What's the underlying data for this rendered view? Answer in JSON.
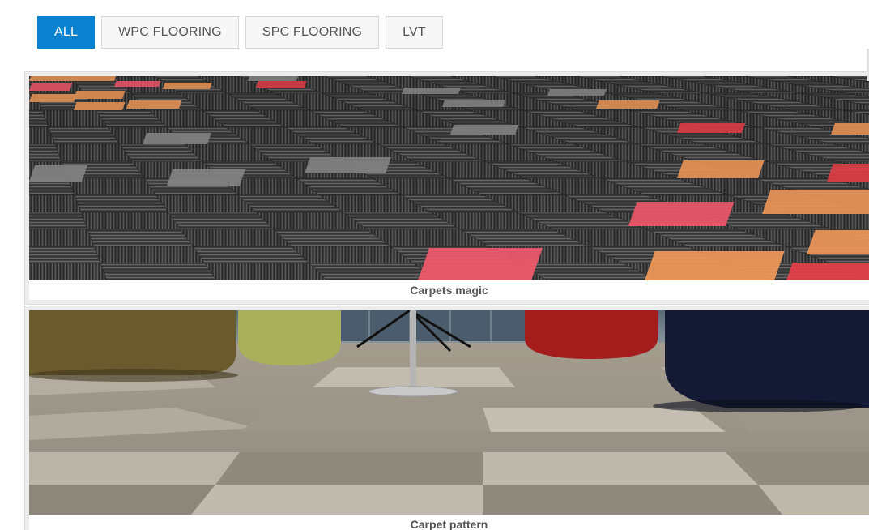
{
  "filters": [
    {
      "label": "ALL",
      "active": true
    },
    {
      "label": "WPC FLOORING",
      "active": false
    },
    {
      "label": "SPC FLOORING",
      "active": false
    },
    {
      "label": "LVT",
      "active": false
    }
  ],
  "gallery": {
    "items": [
      {
        "caption": "Carpets magic"
      },
      {
        "caption": "Carpet pattern"
      }
    ]
  },
  "colors": {
    "accent": "#0a82cf",
    "tile_dark": "#3a3a3a",
    "tile_red": "#e8404a",
    "tile_orange": "#f29a5a",
    "tile_pink": "#f35a6e",
    "tile_gray": "#8a8a8a",
    "pouf_olive": "#6b5a2e",
    "pouf_lime": "#a8b15a",
    "pouf_red": "#a51c1c",
    "pouf_navy": "#141a33"
  }
}
